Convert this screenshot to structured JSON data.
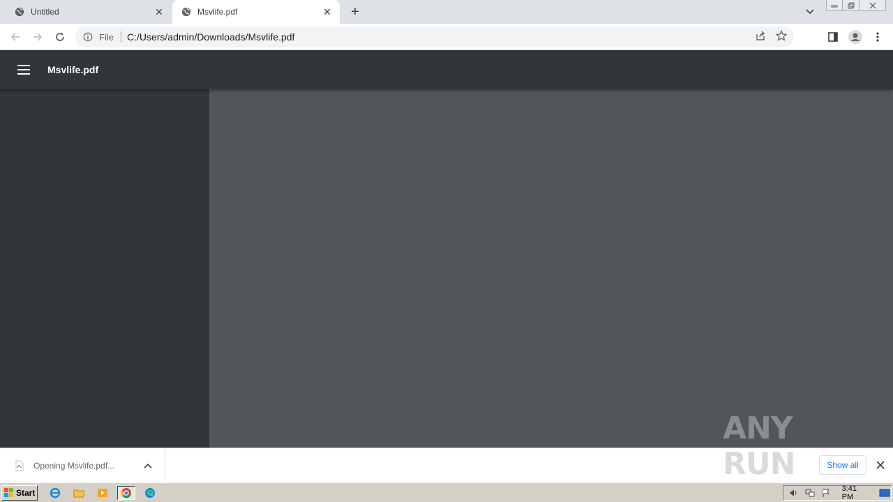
{
  "tabs": [
    {
      "title": "Untitled",
      "active": false
    },
    {
      "title": "Msvlife.pdf",
      "active": true
    }
  ],
  "omnibox": {
    "scheme_label": "File",
    "url": "C:/Users/admin/Downloads/Msvlife.pdf"
  },
  "pdf_viewer": {
    "title": "Msvlife.pdf"
  },
  "download_shelf": {
    "item_text": "Opening Msvlife.pdf...",
    "show_all_label": "Show all"
  },
  "taskbar": {
    "start_label": "Start",
    "clock": "3:41 PM"
  },
  "watermark": {
    "text": "ANY RUN"
  },
  "colors": {
    "tabstrip_bg": "#dee1e6",
    "pdf_toolbar_bg": "#323639",
    "pdf_canvas_bg": "#525659",
    "link_blue": "#1a73e8"
  }
}
